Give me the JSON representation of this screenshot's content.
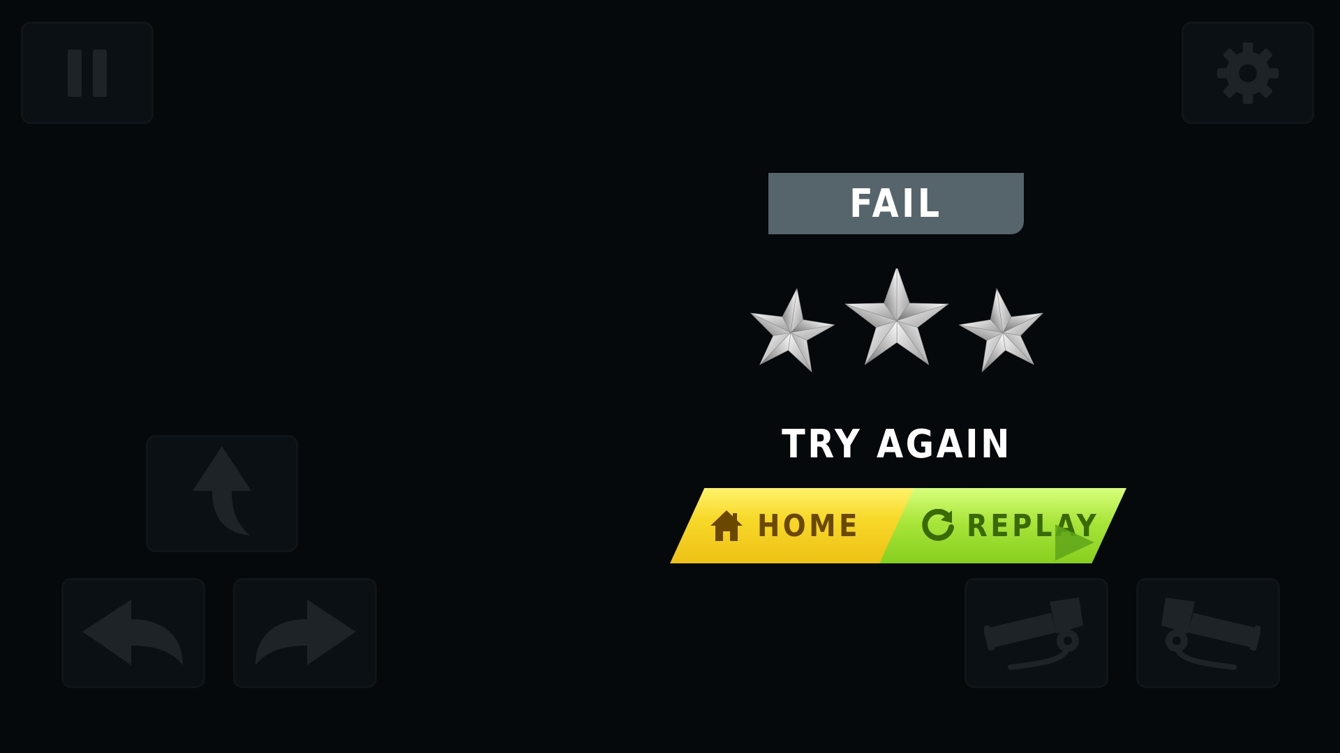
{
  "hud": {
    "pause_icon": "pause-icon",
    "settings_icon": "gear-icon"
  },
  "controls": {
    "up": "arrow-up-icon",
    "left": "arrow-left-icon",
    "right": "arrow-right-icon",
    "cannon_down": "cannon-down-icon",
    "cannon_up": "cannon-up-icon"
  },
  "result": {
    "banner": "FAIL",
    "stars_earned": 0,
    "stars_total": 3,
    "message": "TRY AGAIN"
  },
  "buttons": {
    "home_label": "HOME",
    "home_icon": "home-icon",
    "replay_label": "REPLAY",
    "replay_icon": "replay-icon"
  },
  "colors": {
    "background": "#05090c",
    "banner": "#56646b",
    "home_yellow": "#f7d92a",
    "replay_green": "#a9e53a",
    "control_icon": "#1d2327"
  }
}
